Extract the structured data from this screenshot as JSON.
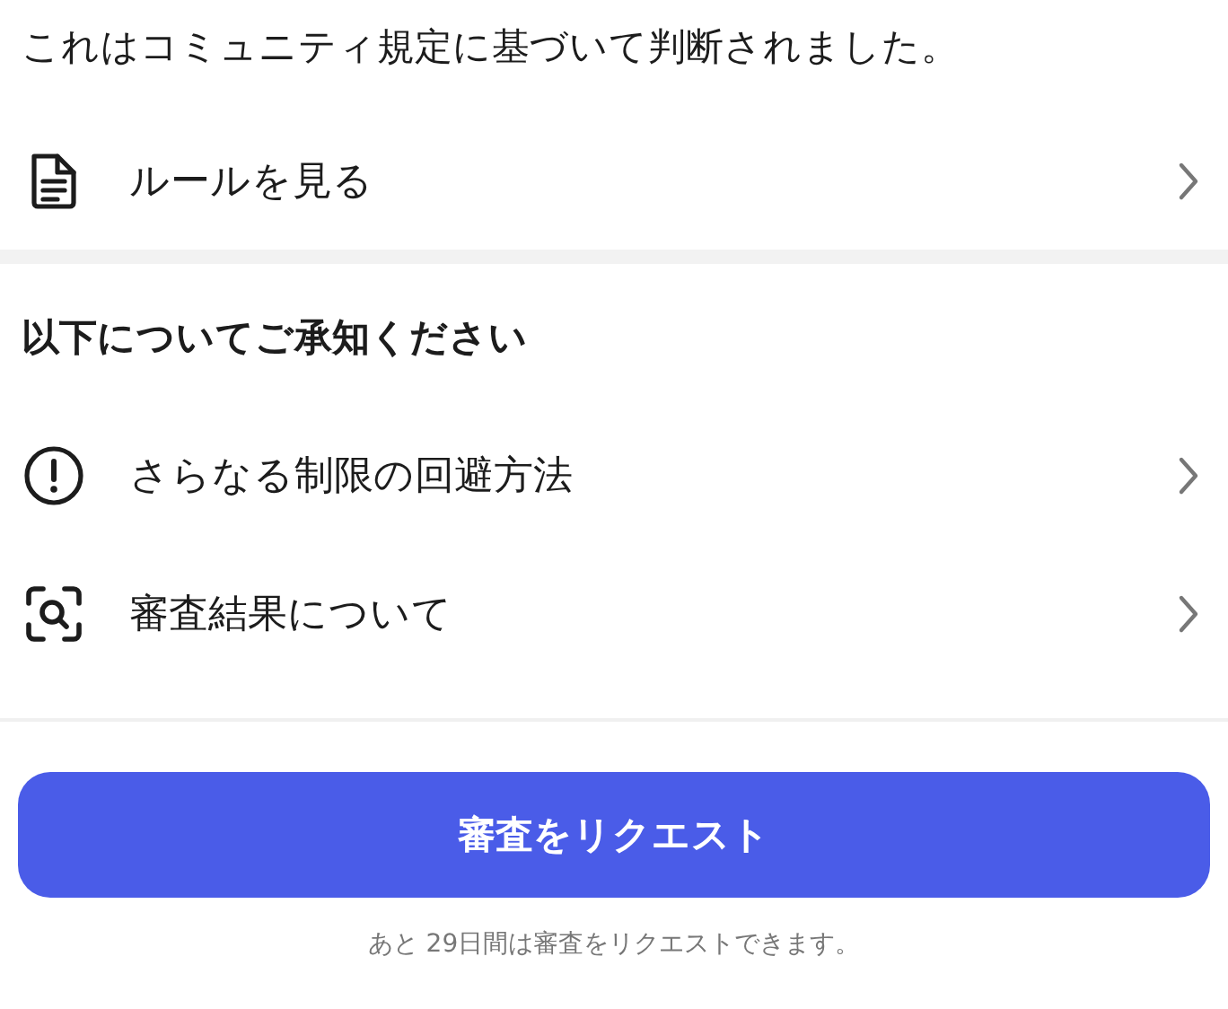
{
  "notice": "これはコミュニティ規定に基づいて判断されました。",
  "rules_link": {
    "kind": "document",
    "label": "ルールを見る"
  },
  "section": {
    "heading": "以下についてご承知ください",
    "items": [
      {
        "kind": "alert",
        "label": "さらなる制限の回避方法"
      },
      {
        "kind": "scan",
        "label": "審査結果について"
      }
    ]
  },
  "button": "審査をリクエスト",
  "footnote": "あと 29日間は審査をリクエストできます。"
}
